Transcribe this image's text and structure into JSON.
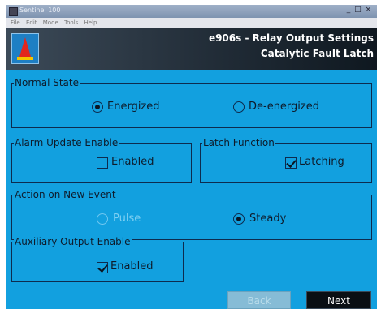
{
  "window": {
    "titlebar_text": "Sentinel 100",
    "controls": "_ □ ×",
    "menu": [
      "File",
      "Edit",
      "Mode",
      "Tools",
      "Help"
    ]
  },
  "header": {
    "title": "e906s - Relay Output Settings",
    "subtitle": "Catalytic Fault Latch"
  },
  "normal_state": {
    "legend": "Normal State",
    "energized_label": "Energized",
    "deenergized_label": "De-energized",
    "selected": "Energized"
  },
  "alarm_update": {
    "legend": "Alarm Update Enable",
    "option_label": "Enabled",
    "checked": false
  },
  "latch_function": {
    "legend": "Latch Function",
    "option_label": "Latching",
    "checked": true
  },
  "action_new_event": {
    "legend": "Action on New Event",
    "pulse_label": "Pulse",
    "steady_label": "Steady",
    "selected": "Steady"
  },
  "aux_output": {
    "legend": "Auxiliary Output Enable",
    "option_label": "Enabled",
    "checked": true
  },
  "buttons": {
    "back_label": "Back",
    "next_label": "Next"
  },
  "colors": {
    "panel_background": "#12a0df",
    "header_background": "#222d38",
    "logo_red": "#e2261d",
    "next_button": "#0a0f14"
  }
}
